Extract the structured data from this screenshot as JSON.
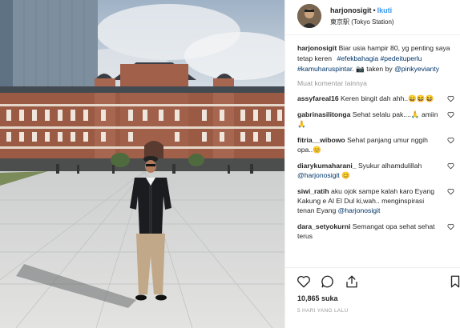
{
  "post": {
    "username": "harjonosigit",
    "dot": "•",
    "follow_label": "Ikuti",
    "location": "東京駅 (Tokyo Station)"
  },
  "caption": {
    "username": "harjonosigit",
    "text_before": "Biar usia hampir 80, yg penting saya tetap keren   ",
    "tags": [
      "#efekbahagia",
      "#pedeituperlu",
      "#kamuharuspintar"
    ],
    "taken_by": ". 📷 taken by ",
    "mention": "@pinkyevianty"
  },
  "load_more_label": "Muat komentar lainnya",
  "comments": [
    {
      "username": "assyfareal16",
      "text": "Keren bingit dah ahh..😄😆😆"
    },
    {
      "username": "gabrinasilitonga",
      "text": "Sehat selalu pak....🙏 amiin 🙏"
    },
    {
      "username": "fitria__wibowo",
      "text": "Sehat panjang umur nggih opa..😊"
    },
    {
      "username": "diarykumaharani_",
      "text": "Syukur alhamdulillah ",
      "mention": "@harjonosigit",
      "suffix": " 😊"
    },
    {
      "username": "siwi_ratih",
      "text": "aku ojok sampe kalah karo Eyang Kakung e Al El Dul ki,wah.. menginspirasi tenan Eyang ",
      "mention": "@harjonosigit"
    },
    {
      "username": "dara_setyokurni",
      "text": "Semangat opa sehat sehat terus"
    }
  ],
  "likes_label": "10,865 suka",
  "time_label": "5 HARI YANG LALU",
  "icons": [
    "heart-icon",
    "comment-icon",
    "share-icon",
    "bookmark-icon"
  ],
  "colors": {
    "link": "#3897f0",
    "tag": "#003569",
    "muted": "#999999"
  }
}
